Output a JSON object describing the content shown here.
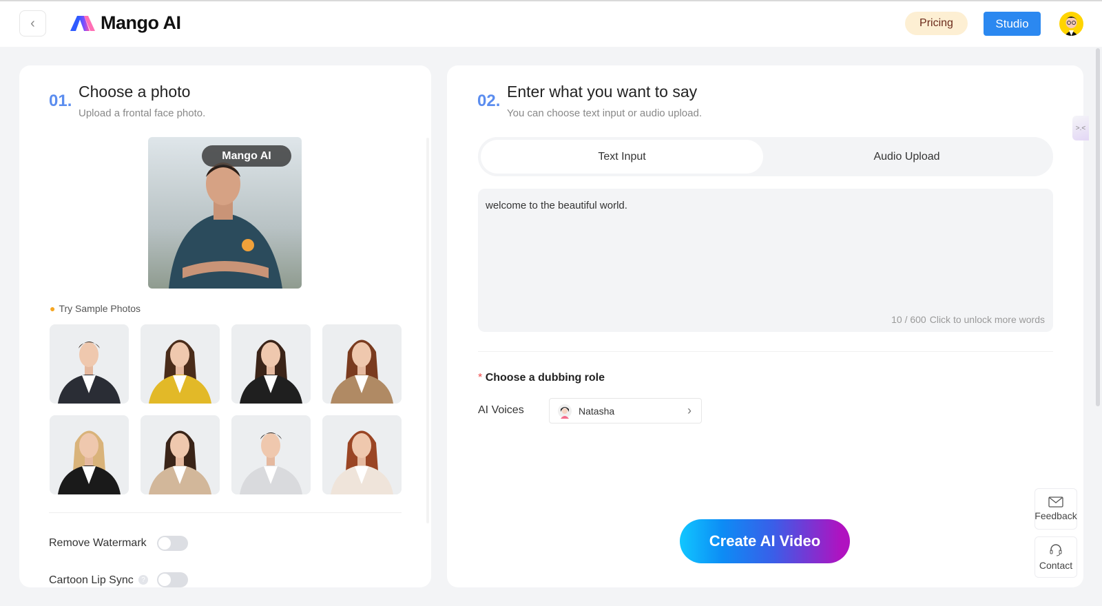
{
  "header": {
    "brand": "Mango AI",
    "pricing": "Pricing",
    "studio": "Studio"
  },
  "step1": {
    "number": "01.",
    "title": "Choose a photo",
    "subtitle": "Upload a frontal face photo.",
    "preview_watermark": "Mango AI",
    "samples_label": "Try Sample Photos",
    "samples": [
      {
        "gender": "male",
        "suit": "#2a2d35",
        "hair": "#3a2a1e"
      },
      {
        "gender": "female",
        "suit": "#e2b928",
        "hair": "#4a2c1a"
      },
      {
        "gender": "female",
        "suit": "#1f1f1f",
        "hair": "#3b2418"
      },
      {
        "gender": "female",
        "suit": "#b08a64",
        "hair": "#7a3b1f"
      },
      {
        "gender": "female",
        "suit": "#1a1a1a",
        "hair": "#d9b37a"
      },
      {
        "gender": "female",
        "suit": "#d2b79a",
        "hair": "#3a2418"
      },
      {
        "gender": "male",
        "suit": "#d9dadd",
        "hair": "#2a211c"
      },
      {
        "gender": "female",
        "suit": "#efe4da",
        "hair": "#9a4524"
      }
    ],
    "remove_watermark": {
      "label": "Remove Watermark",
      "on": false
    },
    "cartoon_lip_sync": {
      "label": "Cartoon Lip Sync",
      "on": false
    }
  },
  "step2": {
    "number": "02.",
    "title": "Enter what you want to say",
    "subtitle": "You can choose text input or audio upload.",
    "tabs": [
      {
        "label": "Text Input",
        "active": true
      },
      {
        "label": "Audio Upload",
        "active": false
      }
    ],
    "text_value": "welcome to the beautiful world.",
    "counter": "10 / 600",
    "unlock": "Click to unlock more words",
    "dubbing_required": "*",
    "dubbing_title": "Choose a dubbing role",
    "voices_label": "AI Voices",
    "voice_selected": "Natasha",
    "create_button": "Create AI Video"
  },
  "side": {
    "feedback": "Feedback",
    "contact": "Contact"
  },
  "colors": {
    "accent": "#2b88f0",
    "step_number": "#5b8def",
    "pricing_bg": "#fdefd3"
  }
}
